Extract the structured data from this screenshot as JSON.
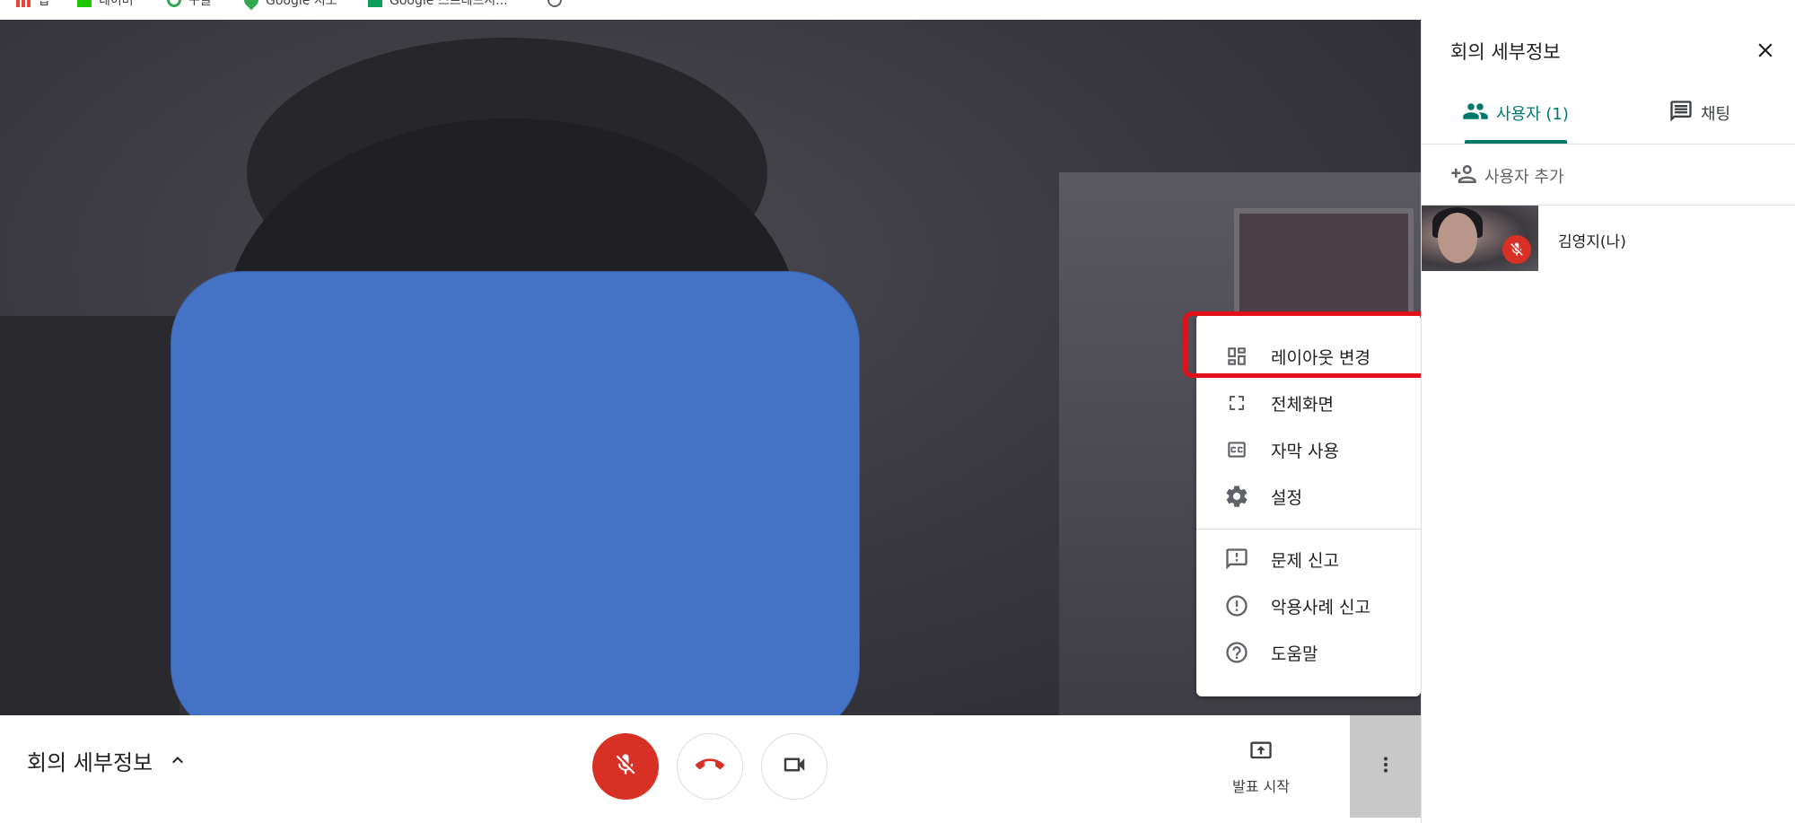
{
  "bookmarks": [
    {
      "label": "앱",
      "icon": "apps-grid-icon"
    },
    {
      "label": "네이버",
      "icon": "naver-icon"
    },
    {
      "label": "구글",
      "icon": "google-icon"
    },
    {
      "label": "Google 지도",
      "icon": "maps-pin-icon"
    },
    {
      "label": "Google 스프레드시...",
      "icon": "sheets-icon"
    }
  ],
  "menu": {
    "items": [
      {
        "label": "레이아웃 변경",
        "icon": "layout-icon"
      },
      {
        "label": "전체화면",
        "icon": "fullscreen-icon"
      },
      {
        "label": "자막 사용",
        "icon": "captions-icon"
      },
      {
        "label": "설정",
        "icon": "settings-gear-icon"
      },
      {
        "label": "문제 신고",
        "icon": "feedback-icon"
      },
      {
        "label": "악용사례 신고",
        "icon": "report-abuse-icon"
      },
      {
        "label": "도움말",
        "icon": "help-icon"
      }
    ]
  },
  "controls": {
    "meeting_details_label": "회의 세부정보",
    "present_label": "발표 시작"
  },
  "panel": {
    "title": "회의 세부정보",
    "tabs": [
      {
        "label": "사용자 (1)",
        "active": true
      },
      {
        "label": "채팅",
        "active": false
      }
    ],
    "add_people_label": "사용자 추가",
    "participants": [
      {
        "name": "김영지(나)",
        "muted": true
      }
    ]
  },
  "colors": {
    "accent": "#00796b",
    "danger": "#d93025",
    "blocker": "#4472c4",
    "highlight": "#e3101a"
  }
}
